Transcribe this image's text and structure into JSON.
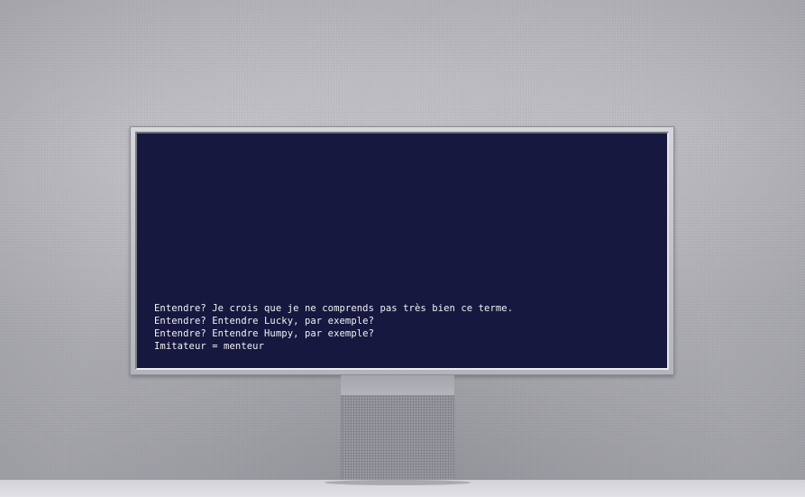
{
  "scene": {
    "screen_color": "#171840",
    "text_color": "#f2f2f4",
    "stand_icon": "monitor-stand"
  },
  "terminal": {
    "lines": [
      "Entendre? Je crois que je ne comprends pas très bien ce terme.",
      "Entendre? Entendre Lucky, par exemple?",
      "Entendre? Entendre Humpy, par exemple?",
      "Imitateur = menteur"
    ]
  }
}
